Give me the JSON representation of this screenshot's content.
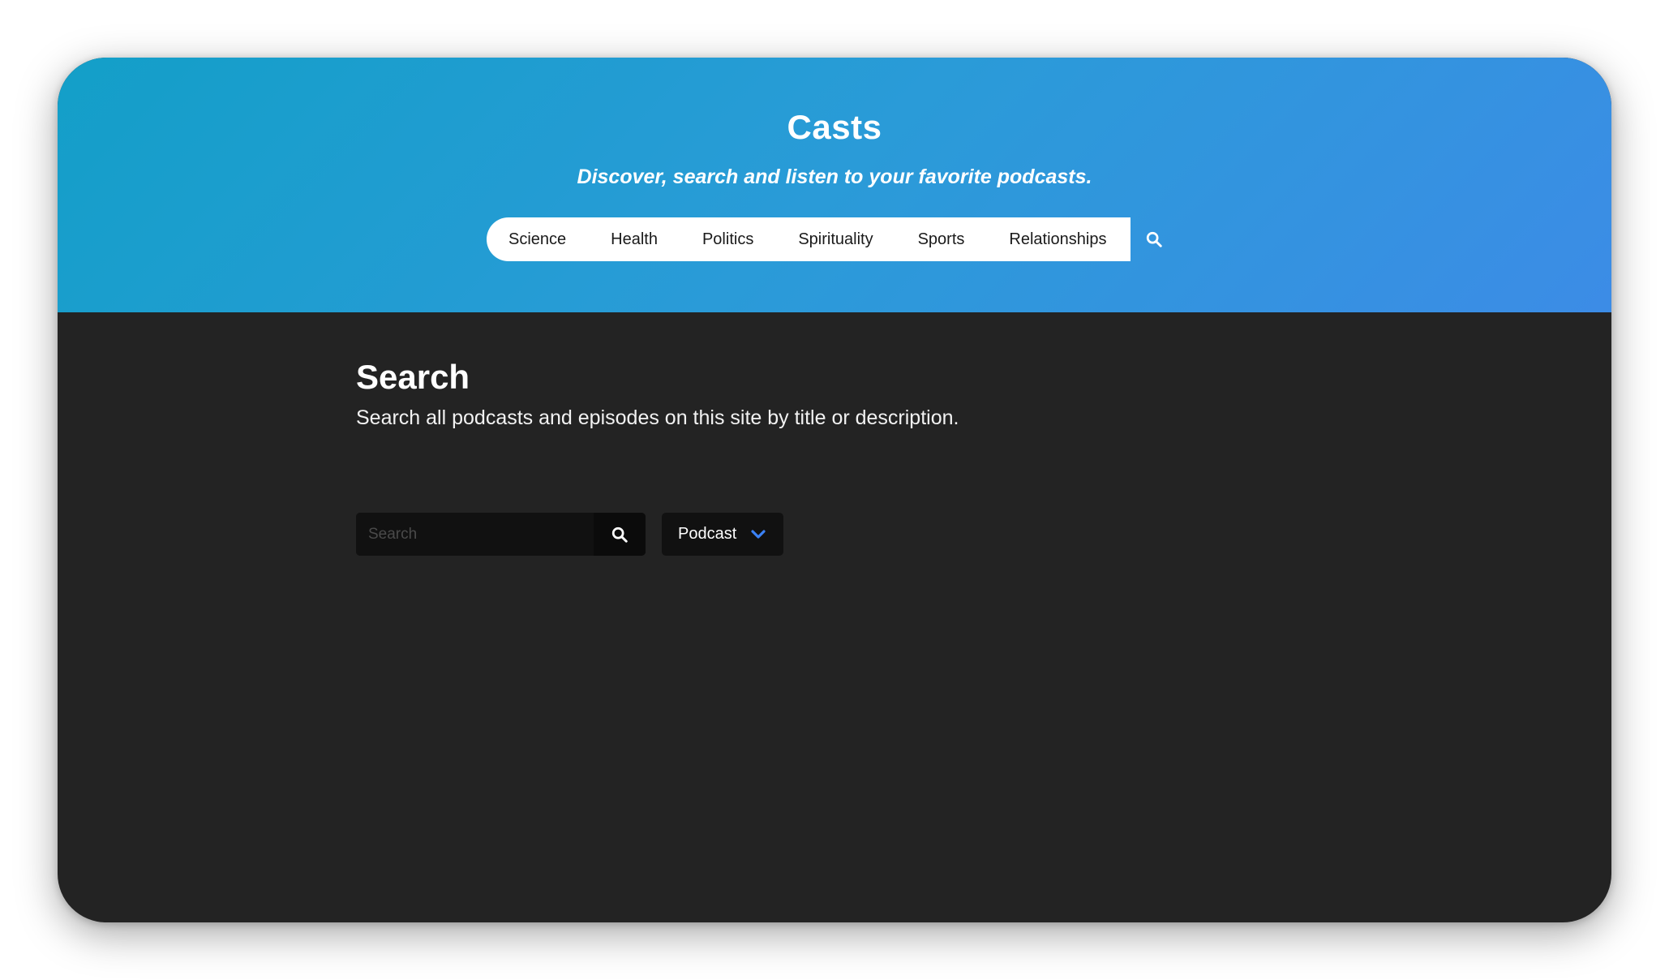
{
  "header": {
    "title": "Casts",
    "tagline": "Discover, search and listen to your favorite podcasts.",
    "nav": [
      {
        "label": "Science"
      },
      {
        "label": "Health"
      },
      {
        "label": "Politics"
      },
      {
        "label": "Spirituality"
      },
      {
        "label": "Sports"
      },
      {
        "label": "Relationships"
      }
    ],
    "search_icon": "search-icon"
  },
  "main": {
    "title": "Search",
    "description": "Search all podcasts and episodes on this site by title or description.",
    "search": {
      "placeholder": "Search",
      "value": "",
      "button_icon": "search-icon"
    },
    "type_select": {
      "selected": "Podcast",
      "icon": "chevron-down-icon"
    }
  },
  "colors": {
    "hero_gradient_start": "#139fc8",
    "hero_gradient_end": "#3c8ce6",
    "body_background": "#232323",
    "input_background": "#111111",
    "chevron_accent": "#3b82f6"
  }
}
